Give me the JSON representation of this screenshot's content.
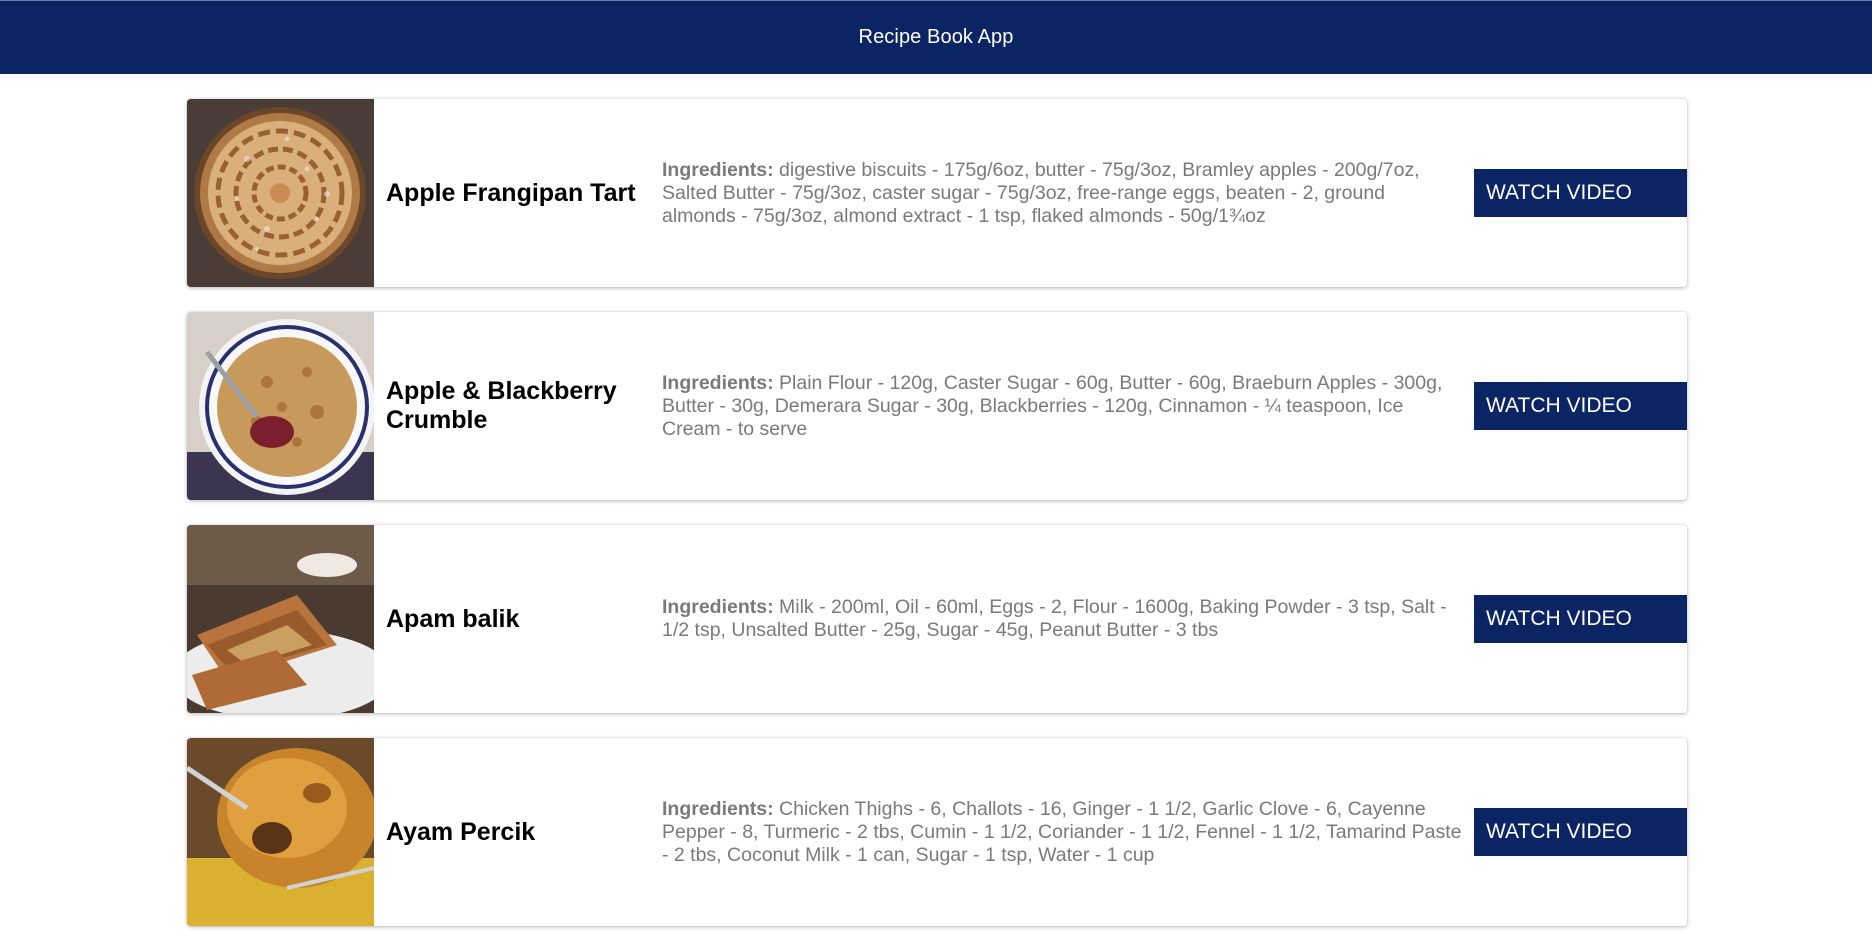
{
  "header": {
    "title": "Recipe Book App",
    "background": "#0b2463"
  },
  "colors": {
    "button_bg": "#0b2463",
    "ingredients_text": "#7a7a7a"
  },
  "recipes": [
    {
      "name": "Apple Frangipan Tart",
      "ingredients_label": "Ingredients:",
      "ingredients": "digestive biscuits - 175g/6oz, butter - 75g/3oz, Bramley apples - 200g/7oz, Salted Butter - 75g/3oz, caster sugar - 75g/3oz, free-range eggs, beaten - 2, ground almonds - 75g/3oz, almond extract - 1 tsp, flaked almonds - 50g/1¾oz",
      "button_label": "WATCH VIDEO",
      "image": "tart-photo"
    },
    {
      "name": "Apple & Blackberry Crumble",
      "ingredients_label": "Ingredients:",
      "ingredients": "Plain Flour - 120g, Caster Sugar - 60g, Butter - 60g, Braeburn Apples - 300g, Butter - 30g, Demerara Sugar - 30g, Blackberries - 120g, Cinnamon - ¼ teaspoon, Ice Cream - to serve",
      "button_label": "WATCH VIDEO",
      "image": "crumble-photo"
    },
    {
      "name": "Apam balik",
      "ingredients_label": "Ingredients:",
      "ingredients": "Milk - 200ml, Oil - 60ml, Eggs - 2, Flour - 1600g, Baking Powder - 3 tsp, Salt - 1/2 tsp, Unsalted Butter - 25g, Sugar - 45g, Peanut Butter - 3 tbs",
      "button_label": "WATCH VIDEO",
      "image": "pancake-photo"
    },
    {
      "name": "Ayam Percik",
      "ingredients_label": "Ingredients:",
      "ingredients": "Chicken Thighs - 6, Challots - 16, Ginger - 1 1/2, Garlic Clove - 6, Cayenne Pepper - 8, Turmeric - 2 tbs, Cumin - 1 1/2, Coriander - 1 1/2, Fennel - 1 1/2, Tamarind Paste - 2 tbs, Coconut Milk - 1 can, Sugar - 1 tsp, Water - 1 cup",
      "button_label": "WATCH VIDEO",
      "image": "chicken-photo"
    }
  ]
}
